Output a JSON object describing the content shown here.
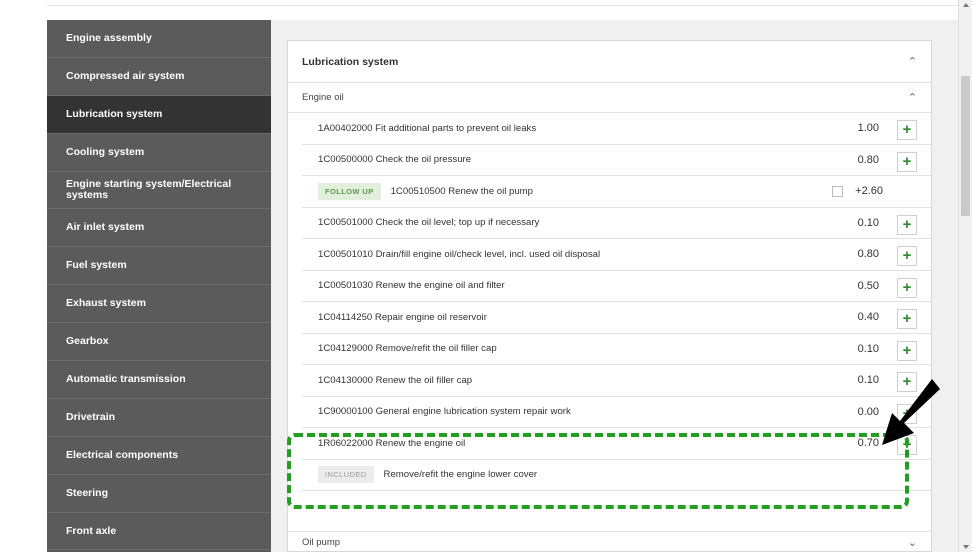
{
  "sidebar": {
    "items": [
      {
        "label": "Engine assembly"
      },
      {
        "label": "Compressed air system"
      },
      {
        "label": "Lubrication system"
      },
      {
        "label": "Cooling system"
      },
      {
        "label": "Engine starting system/Electrical systems"
      },
      {
        "label": "Air inlet system"
      },
      {
        "label": "Fuel system"
      },
      {
        "label": "Exhaust system"
      },
      {
        "label": "Gearbox"
      },
      {
        "label": "Automatic transmission"
      },
      {
        "label": "Drivetrain"
      },
      {
        "label": "Electrical components"
      },
      {
        "label": "Steering"
      },
      {
        "label": "Front axle"
      }
    ],
    "active_index": 2
  },
  "panel": {
    "title": "Lubrication system",
    "collapse_icon": "chevron-up-icon",
    "group": {
      "title": "Engine oil",
      "collapse_icon": "chevron-up-icon"
    },
    "rows": [
      {
        "text": "1A00402000 Fit additional parts to prevent oil leaks",
        "value": "1.00",
        "action": "+"
      },
      {
        "text": "1C00500000 Check the oil pressure",
        "value": "0.80",
        "action": "+"
      },
      {
        "badge": "FOLLOW UP",
        "text": "1C00510500 Renew the oil pump",
        "value": "+2.60"
      },
      {
        "text": "1C00501000 Check the oil level; top up if necessary",
        "value": "0.10",
        "action": "+"
      },
      {
        "text": "1C00501010 Drain/fill engine oil/check level, incl. used oil disposal",
        "value": "0.80",
        "action": "+"
      },
      {
        "text": "1C00501030 Renew the engine oil and filter",
        "value": "0.50",
        "action": "+"
      },
      {
        "text": "1C04114250 Repair engine oil reservoir",
        "value": "0.40",
        "action": "+"
      },
      {
        "text": "1C04129000 Remove/refit the oil filler cap",
        "value": "0.10",
        "action": "+"
      },
      {
        "text": "1C04130000 Renew the oil filler cap",
        "value": "0.10",
        "action": "+"
      },
      {
        "text": "1C90000100 General engine lubrication system repair work",
        "value": "0.00",
        "action": "+"
      },
      {
        "text": "1R06022000 Renew the engine oil",
        "value": "0.70",
        "action": "+"
      },
      {
        "badge": "INCLUDED",
        "text": "Remove/refit the engine lower cover"
      }
    ],
    "next_group": {
      "title": "Oil pump",
      "expand_icon": "chevron-down-icon"
    }
  },
  "colors": {
    "sidebar_bg": "#5b5b5b",
    "sidebar_active": "#333333",
    "add_green": "#2d8a2d",
    "highlight_green": "#1fa11f"
  }
}
